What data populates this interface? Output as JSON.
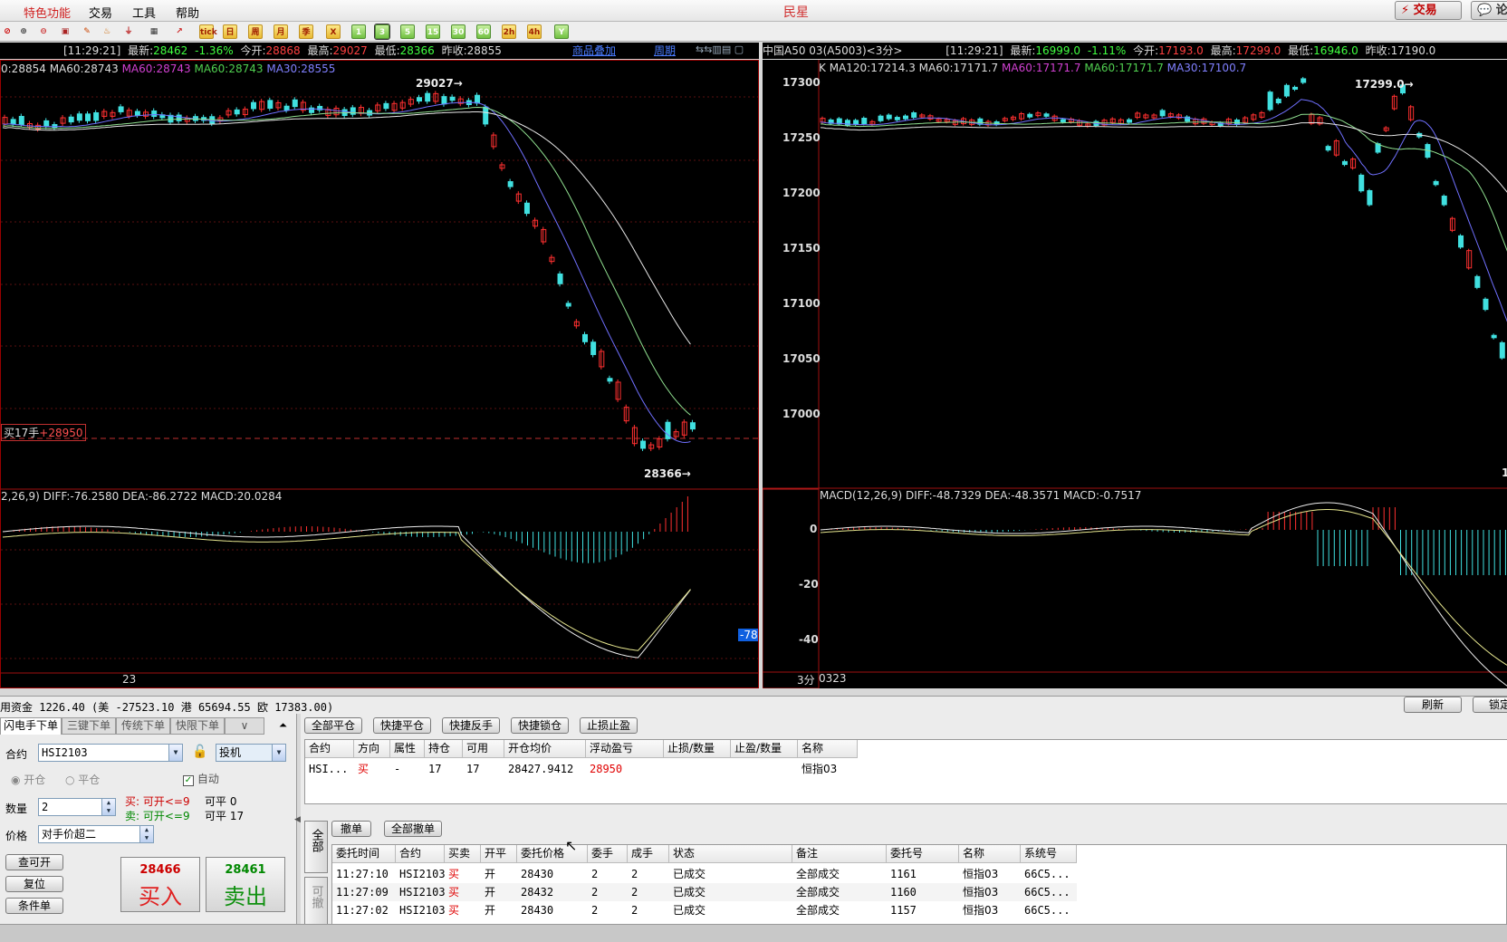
{
  "menu": {
    "items": [
      "特色功能",
      "交易",
      "工具",
      "帮助"
    ],
    "app_title": "民星",
    "trade_button": "⚡ 交易",
    "forum_button": "💬 论"
  },
  "toolbar": {
    "period_buttons": [
      "tick",
      "日",
      "周",
      "月",
      "季",
      "X",
      "1",
      "3",
      "5",
      "15",
      "30",
      "60",
      "2h",
      "4h",
      "Y"
    ],
    "selected_period": "3"
  },
  "left_chart": {
    "header": {
      "time": "[11:29:21]",
      "latest_label": "最新:",
      "latest": "28462",
      "change": "-1.36%",
      "open_label": "今开:",
      "open": "28868",
      "high_label": "最高:",
      "high": "29027",
      "low_label": "最低:",
      "low": "28366",
      "prev_close_label": "昨收:",
      "prev_close": "28855",
      "overlay_link": "商品叠加",
      "period_link": "周期"
    },
    "ma_line": {
      "ma_a": "0:28854",
      "ma60_a": "MA60:28743",
      "ma60_b": "MA60:28743",
      "ma60_c": "MA60:28743",
      "ma30": "MA30:28555"
    },
    "high_marker": "29027→",
    "low_marker": "28366→",
    "position_label": "买17手",
    "position_price": "+28950",
    "macd_label": "2,26,9) DIFF:-76.2580 DEA:-86.2722 MACD:20.0284",
    "macd_value_tag": "-78",
    "x_label": "23",
    "colors": {
      "up": "#ff3030",
      "down": "#40e0e0",
      "ma_white": "#e8e8e8",
      "ma_blue": "#7070ff",
      "ma_green": "#90e090"
    }
  },
  "right_chart": {
    "header": {
      "name": "中国A50 03(A5003)<3分>",
      "time": "[11:29:21]",
      "latest_label": "最新:",
      "latest": "16999.0",
      "change": "-1.11%",
      "open_label": "今开:",
      "open": "17193.0",
      "high_label": "最高:",
      "high": "17299.0",
      "low_label": "最低:",
      "low": "16946.0",
      "prev_close_label": "昨收:",
      "prev_close": "17190.0"
    },
    "ma_line": {
      "k": "K",
      "ma120": "MA120:17214.3",
      "ma60_a": "MA60:17171.7",
      "ma60_b": "MA60:17171.7",
      "ma60_c": "MA60:17171.7",
      "ma30": "MA30:17100.7"
    },
    "y_labels": [
      "17300",
      "17250",
      "17200",
      "17150",
      "17100",
      "17050",
      "17000"
    ],
    "high_marker": "17299.0→",
    "edge_digit": "1",
    "macd_label": "MACD(12,26,9) DIFF:-48.7329 DEA:-48.3571 MACD:-0.7517",
    "macd_y_labels": [
      "0",
      "-20",
      "-40"
    ],
    "x_period": "3分",
    "x_label": "0323"
  },
  "fund_bar": {
    "text": "用资金 1226.40 (美 -27523.10 港 65694.55 欧 17383.00)",
    "refresh": "刷新",
    "lock": "锁定"
  },
  "order_panel": {
    "tabs": [
      "闪电手下单",
      "三键下单",
      "传统下单",
      "快限下单",
      "∨"
    ],
    "contract_label": "合约",
    "contract": "HSI2103",
    "hedge": "投机",
    "open_label": "开仓",
    "close_label": "平仓",
    "auto_label": "自动",
    "qty_label": "数量",
    "qty": "2",
    "buy_info": "买: 可开<=9",
    "sell_info": "卖: 可开<=9",
    "buy_close": "可平 0",
    "sell_close": "可平 17",
    "price_label": "价格",
    "price_mode": "对手价超二",
    "query_btn": "查可开",
    "reset_btn": "复位",
    "cond_btn": "条件单",
    "buy_price": "28466",
    "buy_label": "买入",
    "sell_price": "28461",
    "sell_label": "卖出"
  },
  "positions": {
    "buttons": [
      "全部平仓",
      "快捷平仓",
      "快捷反手",
      "快捷锁仓",
      "止损止盈"
    ],
    "headers": [
      "合约",
      "方向",
      "属性",
      "持仓",
      "可用",
      "开仓均价",
      "浮动盈亏",
      "止损/数量",
      "止盈/数量",
      "名称"
    ],
    "rows": [
      [
        "HSI...",
        "买",
        "-",
        "17",
        "17",
        "28427.9412",
        "28950",
        "",
        "",
        "恒指03"
      ]
    ]
  },
  "orders": {
    "side_tabs": [
      "全部",
      "可撤"
    ],
    "buttons": [
      "撤单",
      "全部撤单"
    ],
    "headers": [
      "委托时间",
      "合约",
      "买卖",
      "开平",
      "委托价格",
      "委手",
      "成手",
      "状态",
      "备注",
      "委托号",
      "名称",
      "系统号"
    ],
    "rows": [
      [
        "11:27:10",
        "HSI2103",
        "买",
        "开",
        "28430",
        "2",
        "2",
        "已成交",
        "全部成交",
        "1161",
        "恒指03",
        "66C5..."
      ],
      [
        "11:27:09",
        "HSI2103",
        "买",
        "开",
        "28432",
        "2",
        "2",
        "已成交",
        "全部成交",
        "1160",
        "恒指03",
        "66C5..."
      ],
      [
        "11:27:02",
        "HSI2103",
        "买",
        "开",
        "28430",
        "2",
        "2",
        "已成交",
        "全部成交",
        "1157",
        "恒指03",
        "66C5..."
      ]
    ]
  }
}
